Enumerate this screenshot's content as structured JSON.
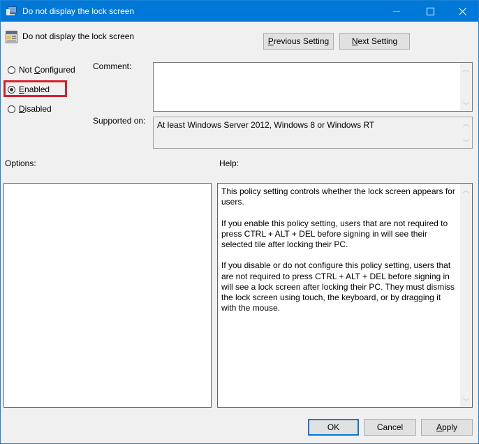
{
  "window": {
    "title": "Do not display the lock screen",
    "controls": {
      "minimize": "—",
      "maximize": "☐",
      "close": "✕"
    }
  },
  "header": {
    "policy_name": "Do not display the lock screen",
    "previous_setting": {
      "prefix": "",
      "mnemonic": "P",
      "rest": "revious Setting"
    },
    "next_setting": {
      "prefix": "",
      "mnemonic": "N",
      "rest": "ext Setting"
    }
  },
  "state": {
    "options": [
      {
        "prefix": "Not ",
        "mnemonic": "C",
        "rest": "onfigured",
        "checked": false
      },
      {
        "prefix": "",
        "mnemonic": "E",
        "rest": "nabled",
        "checked": true
      },
      {
        "prefix": "",
        "mnemonic": "D",
        "rest": "isabled",
        "checked": false
      }
    ],
    "highlight_color": "#d9212b"
  },
  "comment": {
    "label": "Comment:",
    "value": ""
  },
  "supported": {
    "label": "Supported on:",
    "value": "At least Windows Server 2012, Windows 8 or Windows RT"
  },
  "options_panel": {
    "label": "Options:"
  },
  "help_panel": {
    "label": "Help:",
    "paragraphs": [
      "This policy setting controls whether the lock screen appears for users.",
      "If you enable this policy setting, users that are not required to press CTRL + ALT + DEL before signing in will see their selected tile after locking their PC.",
      "If you disable or do not configure this policy setting, users that are not required to press CTRL + ALT + DEL before signing in will see a lock screen after locking their PC. They must dismiss the lock screen using touch, the keyboard, or by dragging it with the mouse."
    ]
  },
  "footer": {
    "ok": "OK",
    "cancel": "Cancel",
    "apply": {
      "mnemonic": "A",
      "rest": "pply"
    }
  },
  "colors": {
    "titlebar": "#0078d7",
    "accent_border": "#0078d7"
  }
}
